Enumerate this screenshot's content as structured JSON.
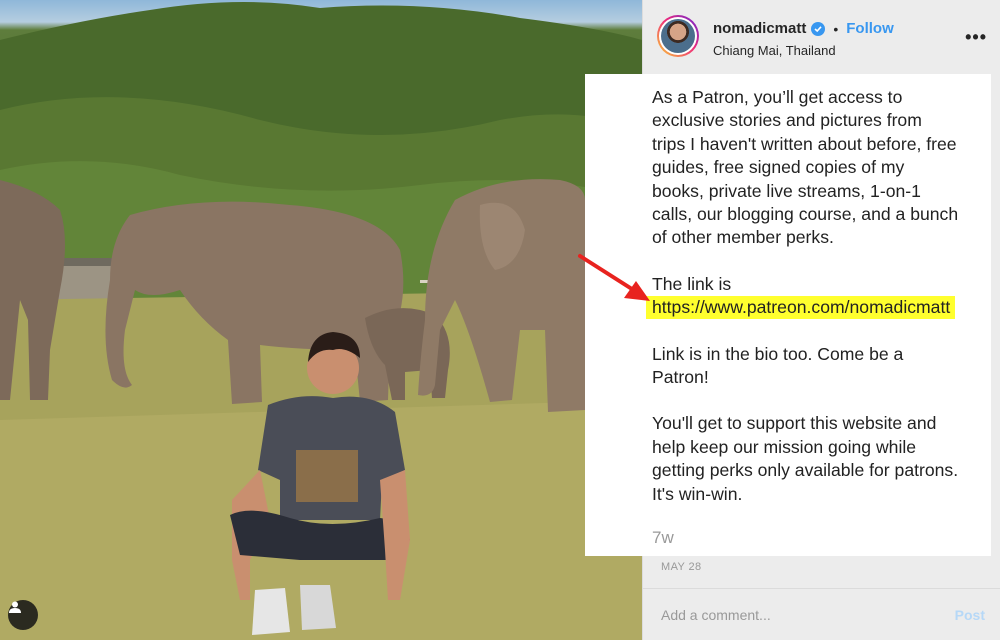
{
  "post": {
    "username": "nomadicmatt",
    "separator": "•",
    "follow_label": "Follow",
    "location": "Chiang Mai, Thailand",
    "more_icon": "more-options-icon"
  },
  "caption": {
    "p1": "As a Patron, you’ll get access to\nexclusive stories and pictures from\ntrips I haven't written about before, free\nguides, free signed copies of my\nbooks, private live streams, 1-on-1\ncalls, our blogging course, and a bunch\nof other member perks.",
    "p2_intro": "The link is",
    "p2_link": "https://www.patreon.com/nomadicmatt",
    "p3": "Link is in the bio too. Come be a\nPatron!",
    "p4": "You'll get to support this website and\nhelp keep our mission going while\ngetting perks only available for patrons.\nIt's win-win.",
    "time_ago": "7w"
  },
  "date": "MAY 28",
  "comment": {
    "placeholder": "Add a comment...",
    "post_label": "Post"
  },
  "colors": {
    "link_highlight": "#ffff2e",
    "follow_blue": "#3897f0",
    "arrow_red": "#e8231f"
  }
}
